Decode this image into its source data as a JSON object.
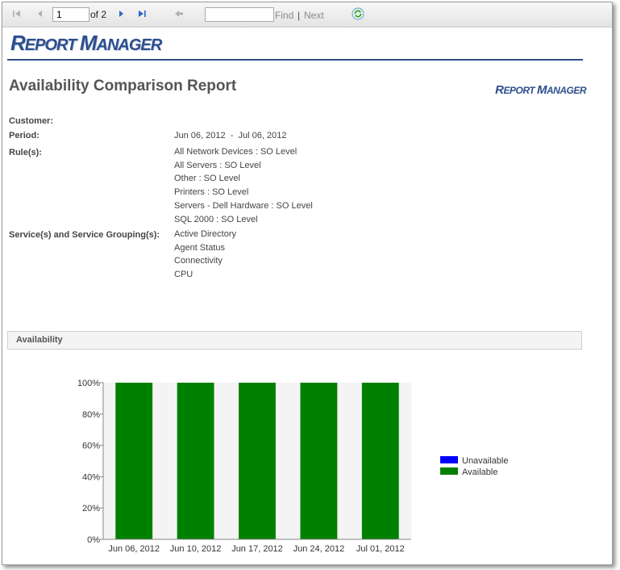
{
  "toolbar": {
    "page_value": "1",
    "page_of": "of 2",
    "find_label": "Find",
    "separator": "|",
    "next_label": "Next",
    "icons": [
      "first-page-icon",
      "previous-page-icon",
      "next-page-icon",
      "last-page-icon",
      "back-icon",
      "refresh-icon"
    ]
  },
  "header": {
    "logo_text_1": "R",
    "logo_text_2": "EPORT ",
    "logo_text_3": "M",
    "logo_text_4": "ANAGER",
    "brand_color": "#2d4e8c"
  },
  "report": {
    "title": "Availability Comparison Report",
    "customer_label": "Customer:",
    "customer_value": "",
    "period_label": "Period:",
    "period_value": "Jun 06, 2012  -  Jul 06, 2012",
    "rules_label": "Rule(s):",
    "rules": [
      "All Network Devices : SO Level",
      "All Servers : SO Level",
      "Other : SO Level",
      "Printers : SO Level",
      "Servers - Dell Hardware : SO Level",
      "SQL 2000 : SO Level"
    ],
    "services_label": "Service(s) and Service Grouping(s):",
    "services": [
      "Active Directory",
      "Agent Status",
      "Connectivity",
      "CPU"
    ]
  },
  "section": {
    "availability_label": "Availability"
  },
  "chart_data": {
    "type": "bar",
    "stacked": true,
    "categories": [
      "Jun 06, 2012",
      "Jun 10, 2012",
      "Jun 17, 2012",
      "Jun 24, 2012",
      "Jul 01, 2012"
    ],
    "series": [
      {
        "name": "Unavailable",
        "values": [
          0,
          0,
          0,
          0,
          0
        ],
        "color": "#0000ff"
      },
      {
        "name": "Available",
        "values": [
          100,
          100,
          100,
          100,
          100
        ],
        "color": "#008000"
      }
    ],
    "ylim": [
      0,
      100
    ],
    "yticks": [
      "0%",
      "20%",
      "40%",
      "60%",
      "80%",
      "100%"
    ],
    "legend_position": "right",
    "grid": false
  }
}
